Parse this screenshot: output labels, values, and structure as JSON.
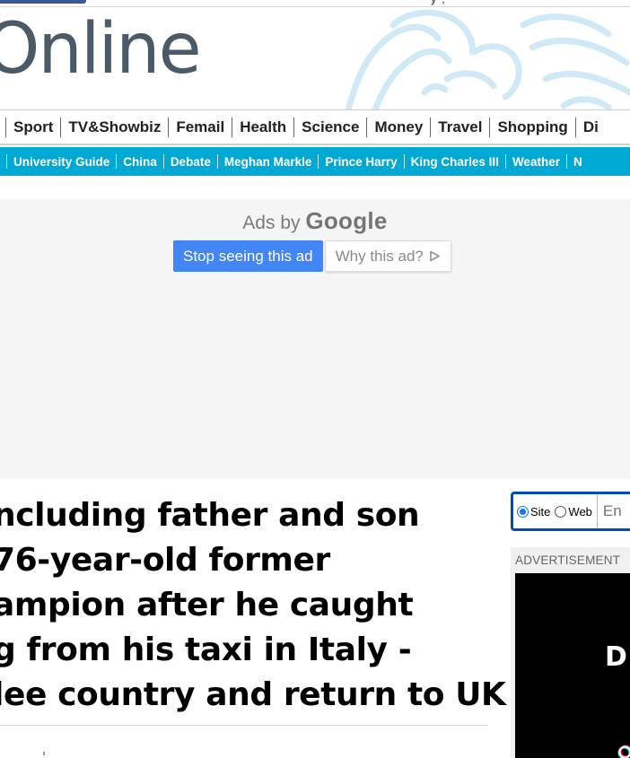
{
  "masthead": {
    "logo_text": "Online",
    "topbar_fragment": "y ,"
  },
  "nav_primary": {
    "items": [
      {
        "label": "Sport"
      },
      {
        "label": "TV&Showbiz"
      },
      {
        "label": "Femail"
      },
      {
        "label": "Health"
      },
      {
        "label": "Science"
      },
      {
        "label": "Money"
      },
      {
        "label": "Travel"
      },
      {
        "label": "Shopping"
      },
      {
        "label": "Di"
      }
    ]
  },
  "nav_secondary": {
    "items": [
      {
        "label": "University Guide"
      },
      {
        "label": "China"
      },
      {
        "label": "Debate"
      },
      {
        "label": "Meghan Markle"
      },
      {
        "label": "Prince Harry"
      },
      {
        "label": "King Charles III"
      },
      {
        "label": "Weather"
      },
      {
        "label": "N"
      }
    ]
  },
  "ad": {
    "ads_by": "Ads by",
    "google": "Google",
    "stop_label": "Stop seeing this ad",
    "why_label": "Why this ad?",
    "background_color": "#f5f5f5",
    "stop_button_color": "#4285f4"
  },
  "article": {
    "headline_lines": [
      "ncluding father and son",
      "76-year-old former",
      "ampion after he caught",
      "g from his taxi in Italy -",
      "lee country and return to UK"
    ]
  },
  "sidebar": {
    "search": {
      "options": [
        {
          "label": "Site",
          "checked": true
        },
        {
          "label": "Web",
          "checked": false
        }
      ],
      "placeholder": "En",
      "border_color": "#004db3"
    },
    "advert": {
      "label": "ADVERTISEMENT",
      "video_text": "D"
    }
  },
  "colors": {
    "secondary_nav_bg": "#00a9d4",
    "logo_color": "#4a5a66",
    "crest_color": "#cfeaf6"
  },
  "icons": {
    "why_ad": "ad-choices-triangle-icon",
    "crest": "lion-crest-icon",
    "advert_logo": "tiktok-logo-icon"
  }
}
